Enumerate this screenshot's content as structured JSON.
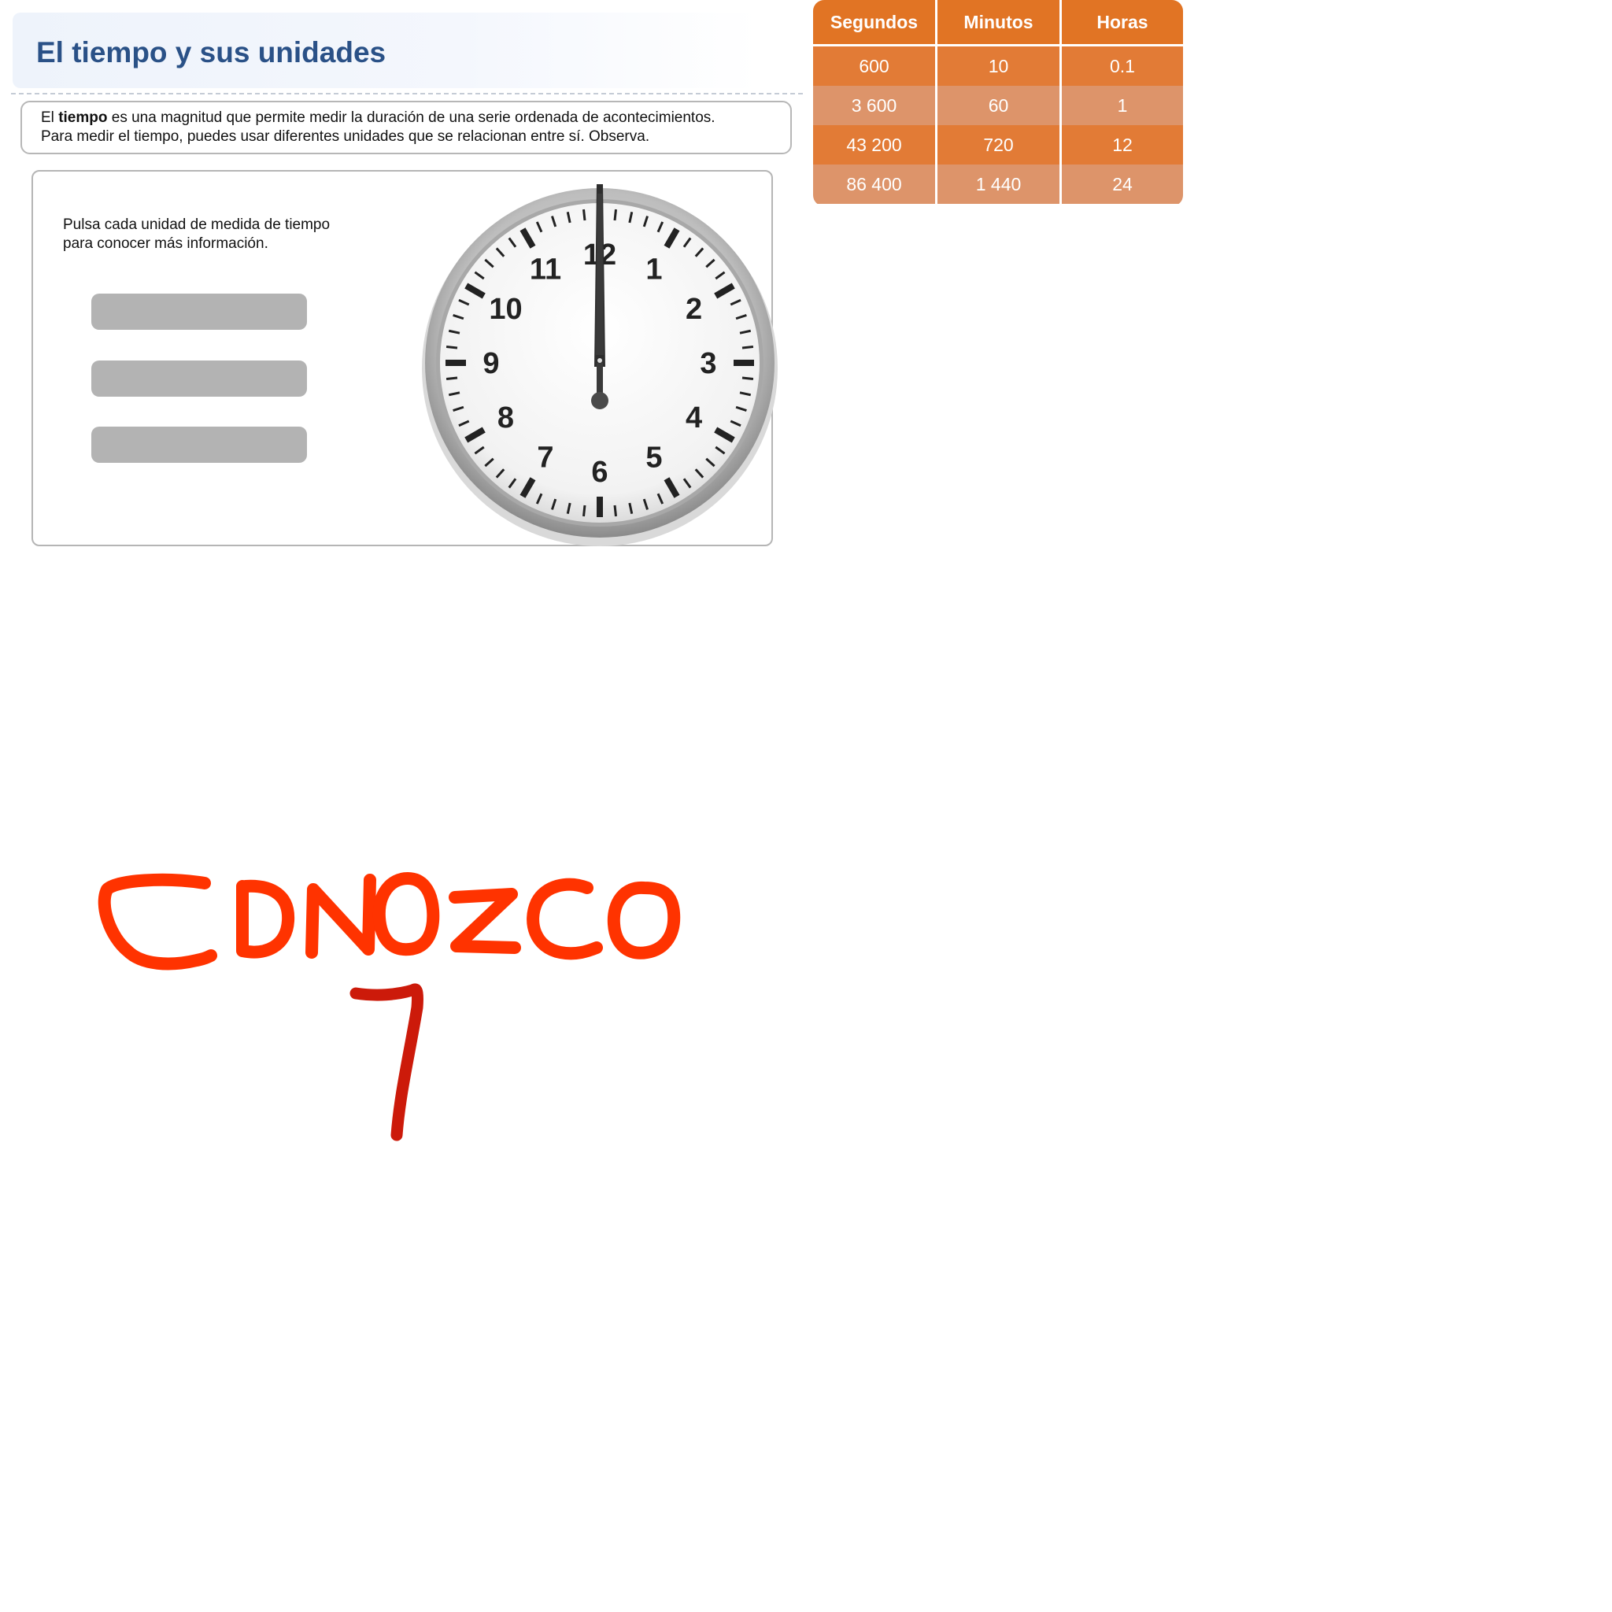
{
  "header": {
    "title": "El tiempo y sus unidades"
  },
  "intro": {
    "line1_prefix": "El ",
    "line1_bold": "tiempo",
    "line1_rest": " es una magnitud que permite medir la duración de una serie ordenada de acontecimientos.",
    "line2": "Para medir el tiempo, puedes usar diferentes unidades que se relacionan entre sí. Observa."
  },
  "panel": {
    "instruction_line1": "Pulsa cada unidad de medida de tiempo",
    "instruction_line2": "para conocer más información.",
    "unit_buttons": [
      "",
      "",
      ""
    ]
  },
  "clock": {
    "numbers": [
      "12",
      "1",
      "2",
      "3",
      "4",
      "5",
      "6",
      "7",
      "8",
      "9",
      "10",
      "11"
    ],
    "time_shown": "12:00"
  },
  "table": {
    "headers": [
      "Segundos",
      "Minutos",
      "Horas"
    ],
    "rows": [
      [
        "600",
        "10",
        "0.1"
      ],
      [
        "3 600",
        "60",
        "1"
      ],
      [
        "43 200",
        "720",
        "12"
      ],
      [
        "86 400",
        "1 440",
        "24"
      ]
    ],
    "colors": {
      "header": "#e17424",
      "row_dark": "#e27b36",
      "row_light": "#dd946a"
    }
  },
  "annotation": {
    "word": "CONOZCO",
    "number": "1",
    "color_word": "#ff3300",
    "color_number": "#cc1a0a"
  }
}
